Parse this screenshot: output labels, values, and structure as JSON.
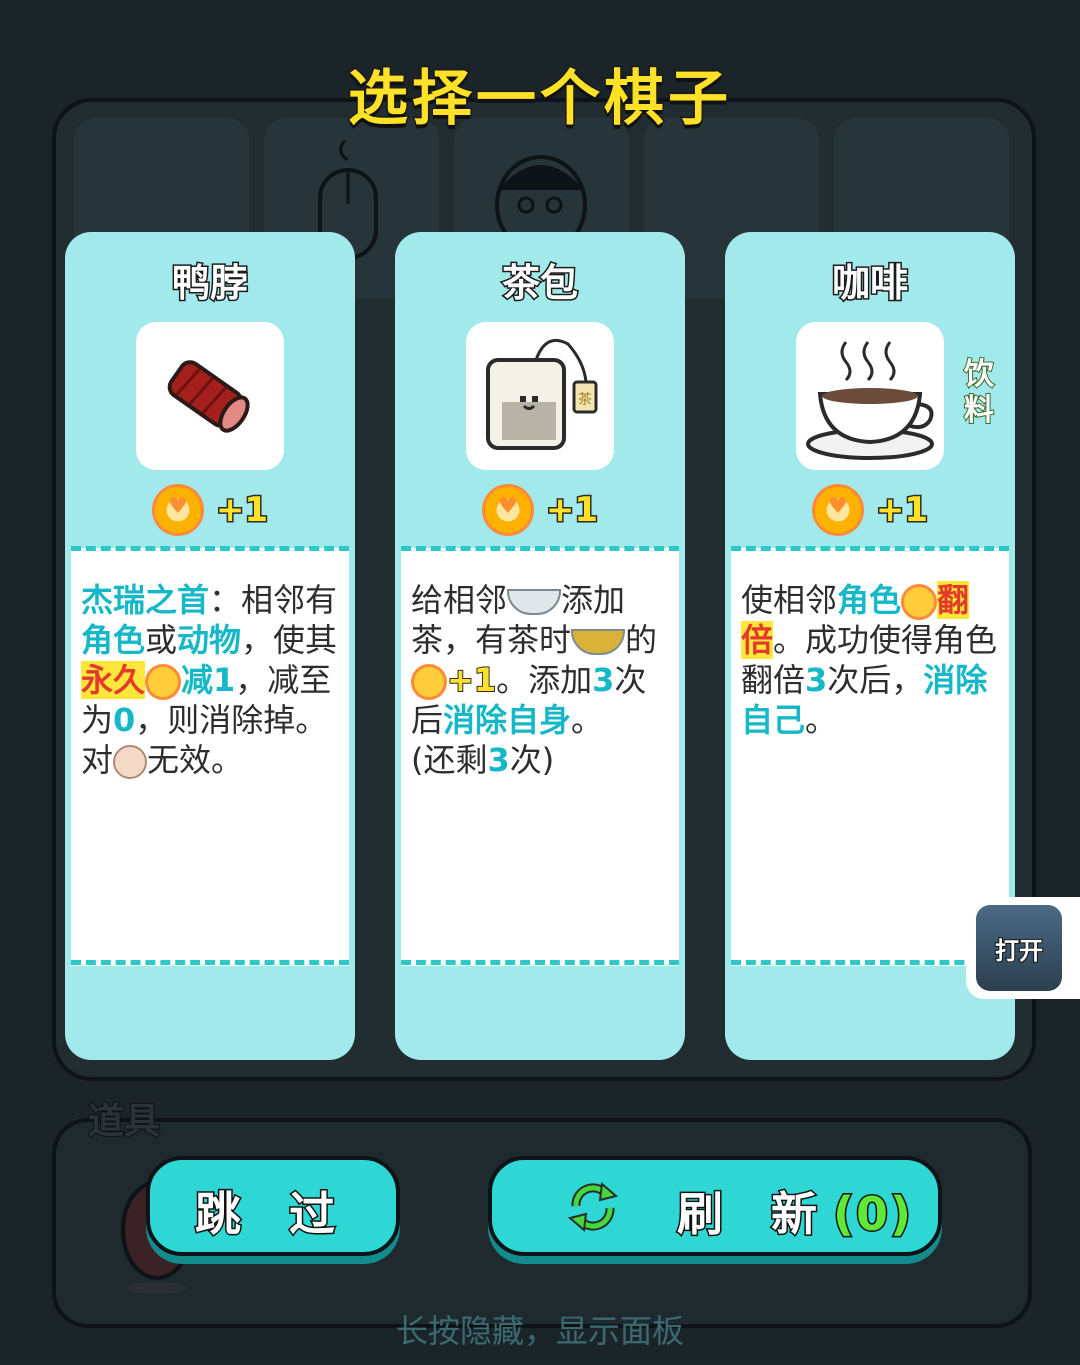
{
  "title": "选择一个棋子",
  "cards": [
    {
      "name": "鸭脖",
      "icon": "duck-neck-sausage-icon",
      "reward": "+1",
      "desc": {
        "kw1": "杰瑞之首",
        "t1": "：相邻有",
        "kw2": "角色",
        "t2": "或",
        "kw3": "动物",
        "t3": "，使其",
        "kw4": "永久",
        "kw5": "减1",
        "t4": "，减至为",
        "kw6": "0",
        "t5": "，则消除掉。",
        "t6": "对",
        "t7": "无效。"
      }
    },
    {
      "name": "茶包",
      "icon": "tea-bag-icon",
      "reward": "+1",
      "desc": {
        "t1": "给相邻",
        "t2": "添加茶，有茶时",
        "t3": "的",
        "kw1": "+1",
        "t4": "。添加",
        "kw2": "3",
        "t5": "次后",
        "kw3": "消除自身",
        "t6": "。",
        "t7": "(还剩",
        "kw4": "3",
        "t8": "次)"
      }
    },
    {
      "name": "咖啡",
      "icon": "coffee-cup-icon",
      "tag": "饮料",
      "reward": "+1",
      "desc": {
        "t1": "使相邻",
        "kw1": "角色",
        "kw2": "翻倍",
        "t2": "。成功使得角色翻倍",
        "kw3": "3",
        "t3": "次后，",
        "kw4": "消除自己",
        "t4": "。"
      }
    }
  ],
  "open_button": "打开",
  "props_label": "道具",
  "skip_button": "跳 过",
  "refresh_button": "刷 新",
  "refresh_count": "(0)",
  "hint": "长按隐藏，显示面板",
  "colors": {
    "background": "#1b2529",
    "card": "#a2e9ec",
    "title": "#ffe227",
    "button": "#2ed7d4",
    "keyword": "#16b8c8"
  }
}
